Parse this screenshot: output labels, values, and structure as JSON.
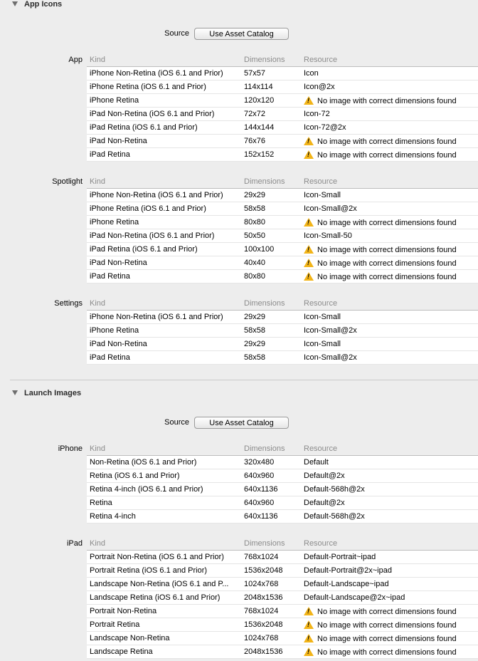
{
  "app_icons": {
    "title": "App Icons",
    "source_label": "Source",
    "button_label": "Use Asset Catalog",
    "groups": [
      {
        "label": "App",
        "columns": [
          "Kind",
          "Dimensions",
          "Resource"
        ],
        "rows": [
          {
            "kind": "iPhone Non-Retina (iOS 6.1 and Prior)",
            "dim": "57x57",
            "res": "Icon",
            "warn": false
          },
          {
            "kind": "iPhone Retina (iOS 6.1 and Prior)",
            "dim": "114x114",
            "res": "Icon@2x",
            "warn": false
          },
          {
            "kind": "iPhone Retina",
            "dim": "120x120",
            "res": "No image with correct dimensions found",
            "warn": true
          },
          {
            "kind": "iPad Non-Retina (iOS 6.1 and Prior)",
            "dim": "72x72",
            "res": "Icon-72",
            "warn": false
          },
          {
            "kind": "iPad Retina (iOS 6.1 and Prior)",
            "dim": "144x144",
            "res": "Icon-72@2x",
            "warn": false
          },
          {
            "kind": "iPad Non-Retina",
            "dim": "76x76",
            "res": "No image with correct dimensions found",
            "warn": true
          },
          {
            "kind": "iPad Retina",
            "dim": "152x152",
            "res": "No image with correct dimensions found",
            "warn": true
          }
        ]
      },
      {
        "label": "Spotlight",
        "columns": [
          "Kind",
          "Dimensions",
          "Resource"
        ],
        "rows": [
          {
            "kind": "iPhone Non-Retina (iOS 6.1 and Prior)",
            "dim": "29x29",
            "res": "Icon-Small",
            "warn": false
          },
          {
            "kind": "iPhone Retina (iOS 6.1 and Prior)",
            "dim": "58x58",
            "res": "Icon-Small@2x",
            "warn": false
          },
          {
            "kind": "iPhone Retina",
            "dim": "80x80",
            "res": "No image with correct dimensions found",
            "warn": true
          },
          {
            "kind": "iPad Non-Retina (iOS 6.1 and Prior)",
            "dim": "50x50",
            "res": "Icon-Small-50",
            "warn": false
          },
          {
            "kind": "iPad Retina (iOS 6.1 and Prior)",
            "dim": "100x100",
            "res": "No image with correct dimensions found",
            "warn": true
          },
          {
            "kind": "iPad Non-Retina",
            "dim": "40x40",
            "res": "No image with correct dimensions found",
            "warn": true
          },
          {
            "kind": "iPad Retina",
            "dim": "80x80",
            "res": "No image with correct dimensions found",
            "warn": true
          }
        ]
      },
      {
        "label": "Settings",
        "columns": [
          "Kind",
          "Dimensions",
          "Resource"
        ],
        "rows": [
          {
            "kind": "iPhone Non-Retina (iOS 6.1 and Prior)",
            "dim": "29x29",
            "res": "Icon-Small",
            "warn": false
          },
          {
            "kind": "iPhone Retina",
            "dim": "58x58",
            "res": "Icon-Small@2x",
            "warn": false
          },
          {
            "kind": "iPad Non-Retina",
            "dim": "29x29",
            "res": "Icon-Small",
            "warn": false
          },
          {
            "kind": "iPad Retina",
            "dim": "58x58",
            "res": "Icon-Small@2x",
            "warn": false
          }
        ]
      }
    ]
  },
  "launch_images": {
    "title": "Launch Images",
    "source_label": "Source",
    "button_label": "Use Asset Catalog",
    "groups": [
      {
        "label": "iPhone",
        "columns": [
          "Kind",
          "Dimensions",
          "Resource"
        ],
        "rows": [
          {
            "kind": "Non-Retina (iOS 6.1 and Prior)",
            "dim": "320x480",
            "res": "Default",
            "warn": false
          },
          {
            "kind": "Retina (iOS 6.1 and Prior)",
            "dim": "640x960",
            "res": "Default@2x",
            "warn": false
          },
          {
            "kind": "Retina 4-inch (iOS 6.1 and Prior)",
            "dim": "640x1136",
            "res": "Default-568h@2x",
            "warn": false
          },
          {
            "kind": "Retina",
            "dim": "640x960",
            "res": "Default@2x",
            "warn": false
          },
          {
            "kind": "Retina 4-inch",
            "dim": "640x1136",
            "res": "Default-568h@2x",
            "warn": false
          }
        ]
      },
      {
        "label": "iPad",
        "columns": [
          "Kind",
          "Dimensions",
          "Resource"
        ],
        "rows": [
          {
            "kind": "Portrait Non-Retina (iOS 6.1 and Prior)",
            "dim": "768x1024",
            "res": "Default-Portrait~ipad",
            "warn": false
          },
          {
            "kind": "Portrait Retina (iOS 6.1 and Prior)",
            "dim": "1536x2048",
            "res": "Default-Portrait@2x~ipad",
            "warn": false
          },
          {
            "kind": "Landscape Non-Retina (iOS 6.1 and P...",
            "dim": "1024x768",
            "res": "Default-Landscape~ipad",
            "warn": false
          },
          {
            "kind": "Landscape Retina (iOS 6.1 and Prior)",
            "dim": "2048x1536",
            "res": "Default-Landscape@2x~ipad",
            "warn": false
          },
          {
            "kind": "Portrait Non-Retina",
            "dim": "768x1024",
            "res": "No image with correct dimensions found",
            "warn": true
          },
          {
            "kind": "Portrait Retina",
            "dim": "1536x2048",
            "res": "No image with correct dimensions found",
            "warn": true
          },
          {
            "kind": "Landscape Non-Retina",
            "dim": "1024x768",
            "res": "No image with correct dimensions found",
            "warn": true
          },
          {
            "kind": "Landscape Retina",
            "dim": "2048x1536",
            "res": "No image with correct dimensions found",
            "warn": true
          }
        ]
      }
    ]
  }
}
